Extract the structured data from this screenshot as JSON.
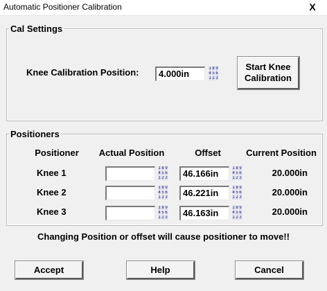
{
  "window": {
    "title": "Automatic Positioner Calibration",
    "close_label": "X"
  },
  "cal_settings": {
    "legend": "Cal Settings",
    "knee_label": "Knee Calibration Position:",
    "knee_value": "4.000in",
    "start_button_line1": "Start Knee",
    "start_button_line2": "Calibration"
  },
  "positioners": {
    "legend": "Positioners",
    "headers": {
      "positioner": "Positioner",
      "actual": "Actual Position",
      "offset": "Offset",
      "current": "Current Position"
    },
    "rows": [
      {
        "name": "Knee 1",
        "actual": "",
        "offset": "46.166in",
        "current": "20.000in"
      },
      {
        "name": "Knee 2",
        "actual": "",
        "offset": "46.221in",
        "current": "20.000in"
      },
      {
        "name": "Knee 3",
        "actual": "",
        "offset": "46.163in",
        "current": "20.000in"
      }
    ]
  },
  "keypad_digits": [
    "1",
    "8",
    "9",
    "4",
    "5",
    "6",
    "1",
    "2",
    "3"
  ],
  "warning": "Changing Position or offset will cause positioner to move!!",
  "buttons": {
    "accept": "Accept",
    "help": "Help",
    "cancel": "Cancel"
  }
}
